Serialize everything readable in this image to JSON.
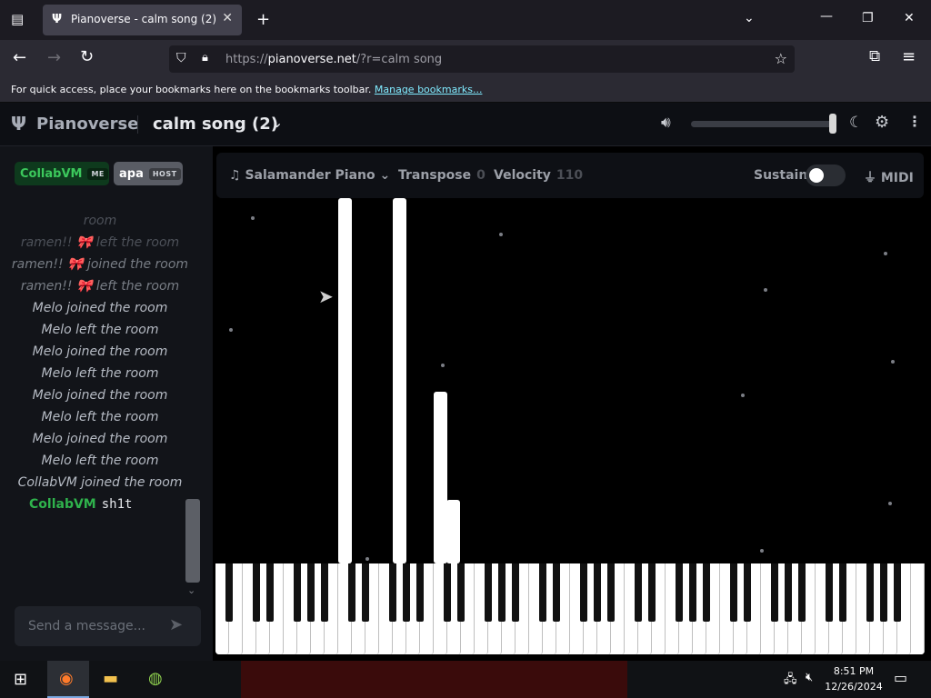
{
  "browser": {
    "tab_title": "Pianoverse - calm song (2)",
    "tab_favicon": "Ψ",
    "url_prefix": "https://",
    "url_host": "pianoverse.net",
    "url_rest": "/?r=calm song",
    "bookmarks_hint": "For quick access, place your bookmarks here on the bookmarks toolbar.",
    "bookmarks_link": "Manage bookmarks..."
  },
  "app": {
    "logo": "Pianoverse",
    "room_title": "calm song (2)",
    "volume_level": 0.98
  },
  "users": [
    {
      "name": "CollabVM",
      "tag": "ME"
    },
    {
      "name": "apa",
      "tag": "HOST"
    }
  ],
  "chat": {
    "messages": [
      {
        "text": "room",
        "tone": "faded"
      },
      {
        "text": "ramen!! 🎀 left the room",
        "tone": "faded"
      },
      {
        "text": "ramen!! 🎀 joined the room",
        "tone": "mid"
      },
      {
        "text": "ramen!! 🎀 left the room",
        "tone": "mid"
      },
      {
        "text": "Melo joined the room",
        "tone": "normal"
      },
      {
        "text": "Melo left the room",
        "tone": "normal"
      },
      {
        "text": "Melo joined the room",
        "tone": "normal"
      },
      {
        "text": "Melo left the room",
        "tone": "normal"
      },
      {
        "text": "Melo joined the room",
        "tone": "normal"
      },
      {
        "text": "Melo left the room",
        "tone": "normal"
      },
      {
        "text": "Melo joined the room",
        "tone": "normal"
      },
      {
        "text": "Melo left the room",
        "tone": "normal"
      },
      {
        "text": "CollabVM joined the room",
        "tone": "normal"
      }
    ],
    "last_user": "CollabVM",
    "last_text": "sh1t",
    "placeholder": "Send a message..."
  },
  "toolbar": {
    "instrument": "Salamander Piano",
    "transpose_label": "Transpose",
    "transpose_value": "0",
    "velocity_label": "Velocity",
    "velocity_value": "110",
    "sustain_label": "Sustain",
    "midi_label": "MIDI"
  },
  "taskbar": {
    "time": "8:51 PM",
    "date": "12/26/2024"
  },
  "colors": {
    "accent_green": "#2fb24c",
    "background": "#000000"
  }
}
